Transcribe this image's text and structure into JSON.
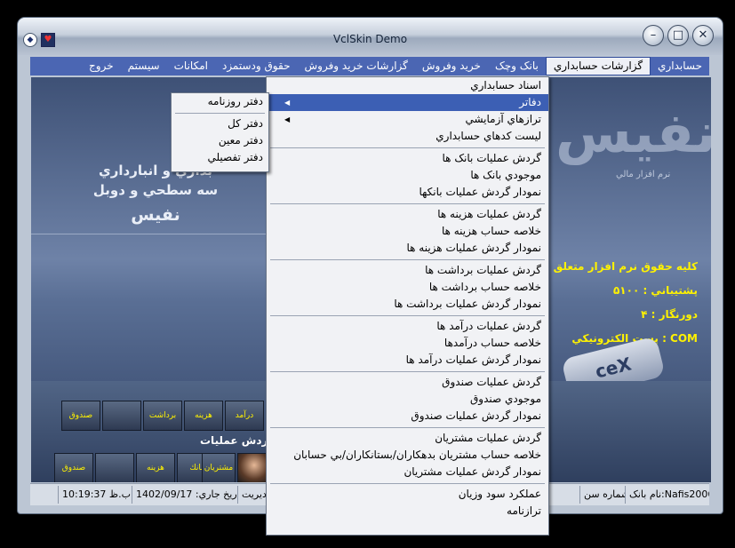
{
  "window": {
    "title": "VclSkin Demo"
  },
  "menubar": [
    "حسابداري",
    "گزارشات حسابداري",
    "بانک وچک",
    "خريد وفروش",
    "گزارشات خريد وفروش",
    "حقوق ودستمزد",
    "امکانات",
    "سيستم",
    "خروج"
  ],
  "background": {
    "logo": "نفيس",
    "logo_sub": "نرم افزار مالي",
    "hero_line1": "بداري و انبارداري",
    "hero_line2": "سه سطحي و دوبل",
    "hero_line3": "نفيس",
    "ticker": [
      "كليه حقوق نرم افزار متعلق به",
      "پشتيباني : ۵۱۰۰",
      "دورنگار : ۴",
      "پست الكترونيكي : COM"
    ],
    "xlogo": "ceX"
  },
  "panel": {
    "group_label": "گردش عمليات",
    "row1_tiles": [
      "صندوق",
      "برداشت",
      "هزينه",
      "درآمد"
    ],
    "row2_tiles": [
      "صندوق",
      "هزينه",
      "بانك",
      "مشتريان"
    ]
  },
  "dropdown": {
    "groups": [
      [
        "اسناد حسابداري",
        "دفاتر",
        "ترازهاي آزمايشي",
        "ليست كدهاي حسابداري"
      ],
      [
        "گردش عمليات بانک ها",
        "موجودي بانک ها",
        "نمودار گردش عمليات بانکها"
      ],
      [
        "گردش عمليات هزينه ها",
        "خلاصه حساب هزينه ها",
        "نمودار گردش عمليات هزينه ها"
      ],
      [
        "گردش عمليات برداشت ها",
        "خلاصه حساب برداشت ها",
        "نمودار گردش عمليات برداشت ها"
      ],
      [
        "گردش عمليات درآمد ها",
        "خلاصه حساب درآمدها",
        "نمودار گردش عمليات درآمد ها"
      ],
      [
        "گردش عمليات صندوق",
        "موجودي صندوق",
        "نمودار گردش عمليات صندوق"
      ],
      [
        "گردش عمليات مشتريان",
        "خلاصه حساب مشتريان  بدهكاران/بستانكاران/بي حسابان",
        "نمودار گردش عمليات مشتريان"
      ],
      [
        "عملکرد سود وزيان",
        "ترازنامه"
      ]
    ]
  },
  "submenu": {
    "items": [
      "دفتر روزنامه",
      "دفتر کل",
      "دفتر معين",
      "دفتر تفصيلي"
    ]
  },
  "statusbar": {
    "bank": "نام بانک:Nafis2006",
    "doc_no": "؛ شماره سن",
    "management": "ي مديريت",
    "date": "تاريخ جاري: 1402/09/17",
    "time": "ب.ظ 10:19:37"
  },
  "colors": {
    "menubar": "#4b66b3",
    "highlight": "#3c5fb4",
    "ticker": "#fff200"
  }
}
